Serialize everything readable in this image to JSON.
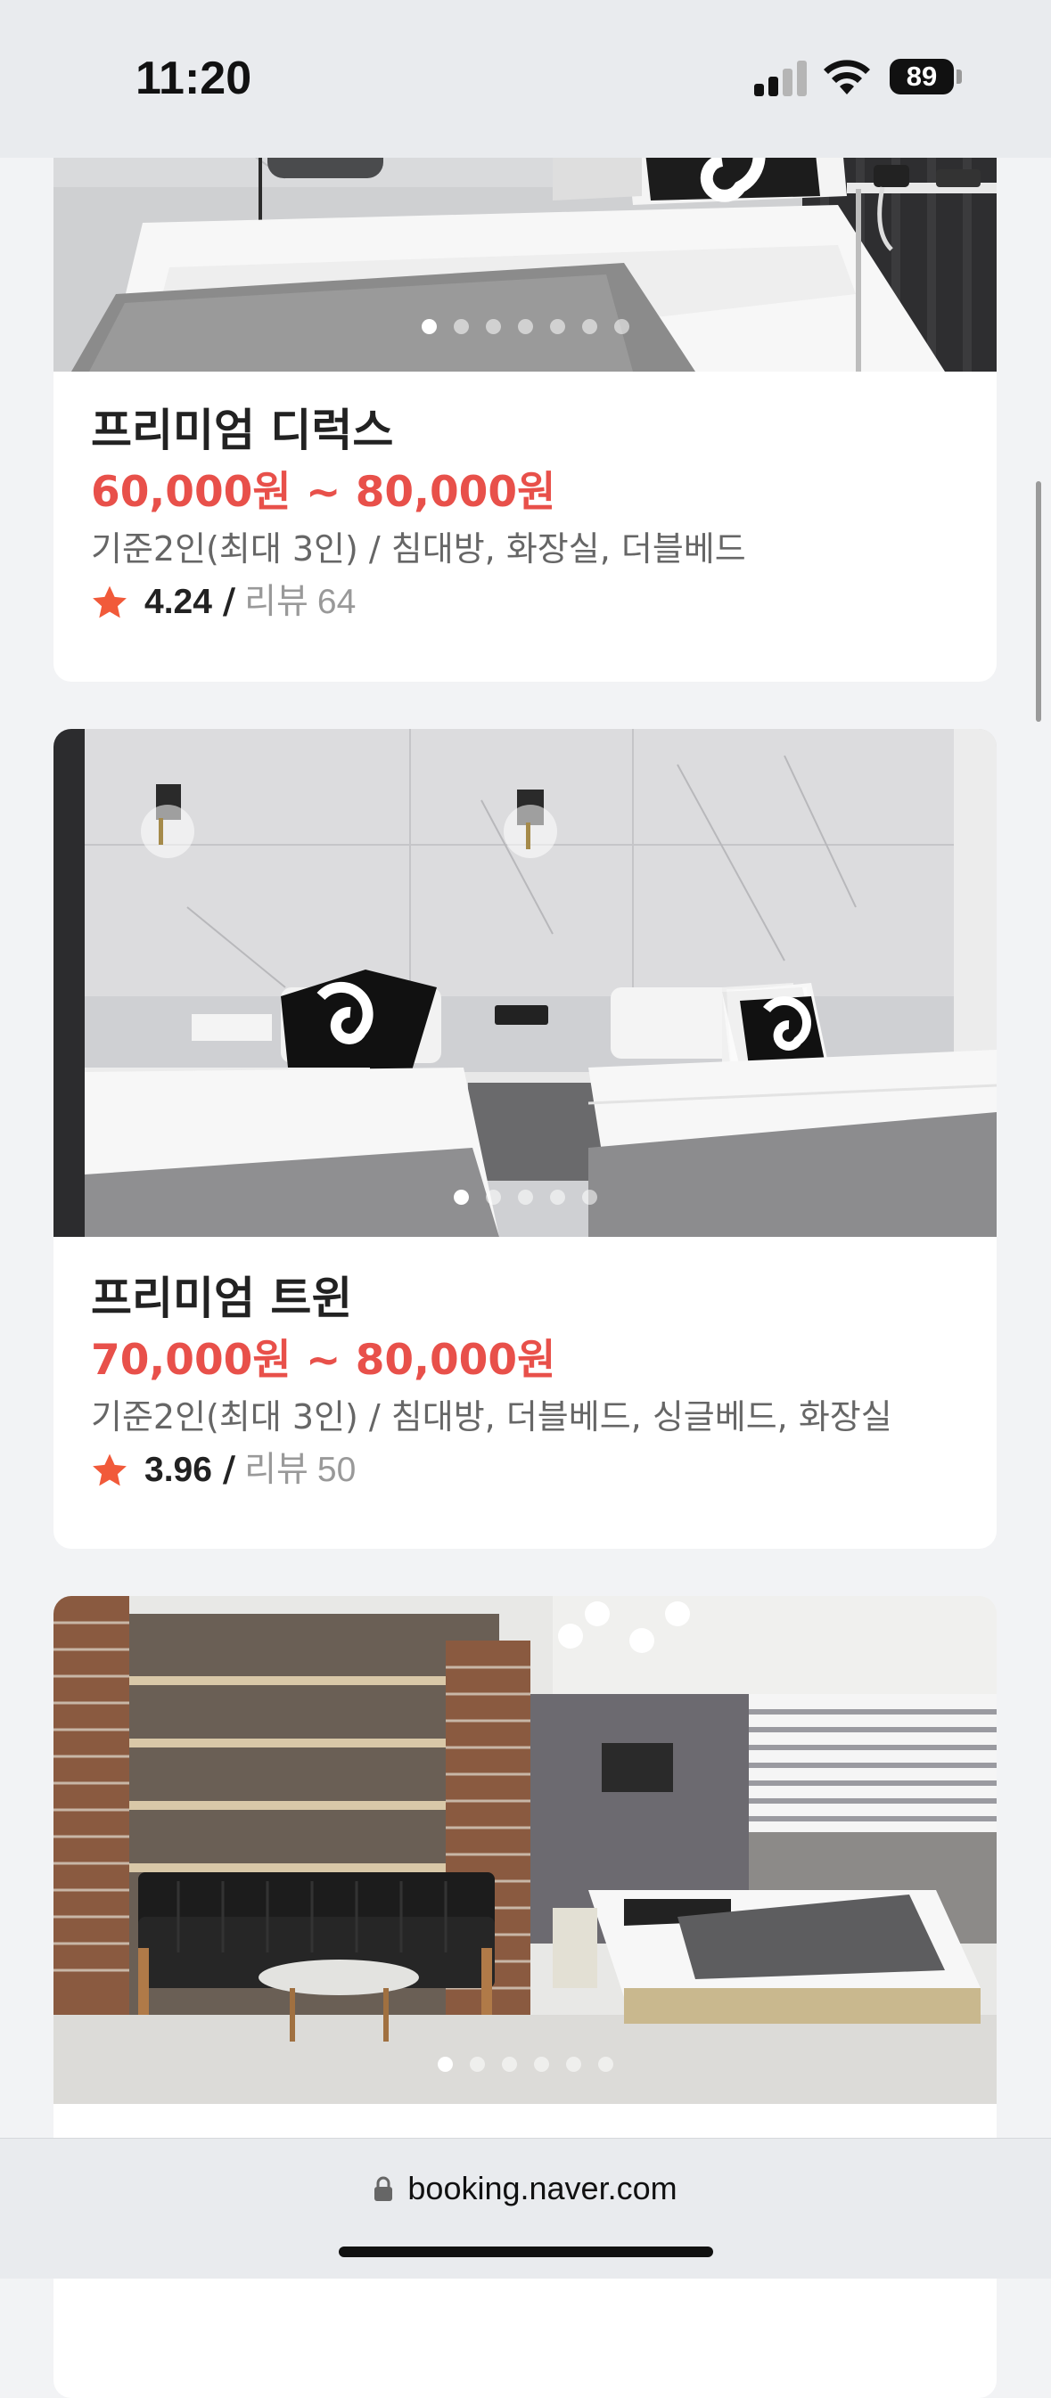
{
  "status_bar": {
    "time": "11:20",
    "battery_level": "89",
    "icons": [
      "signal-icon",
      "wifi-icon",
      "battery-icon"
    ]
  },
  "rooms": [
    {
      "name": "프리미엄 디럭스",
      "price": "60,000원 ~ 80,000원",
      "description": "기준2인(최대 3인) / 침대방, 화장실, 더블베드",
      "rating": "4.24",
      "rating_separator": "/",
      "review_label": "리뷰",
      "review_count": "64",
      "photo_count": 7,
      "photo_index": 1
    },
    {
      "name": "프리미엄 트윈",
      "price": "70,000원 ~ 80,000원",
      "description": "기준2인(최대 3인) / 침대방, 더블베드, 싱글베드, 화장실",
      "rating": "3.96",
      "rating_separator": "/",
      "review_label": "리뷰",
      "review_count": "50",
      "photo_count": 5,
      "photo_index": 1
    },
    {
      "photo_count": 6,
      "photo_index": 1
    }
  ],
  "url_bar": {
    "url": "booking.naver.com",
    "icon": "lock-icon"
  },
  "colors": {
    "price": "#e8504a",
    "star": "#f15a3a",
    "background": "#f2f3f5",
    "card": "#ffffff"
  }
}
